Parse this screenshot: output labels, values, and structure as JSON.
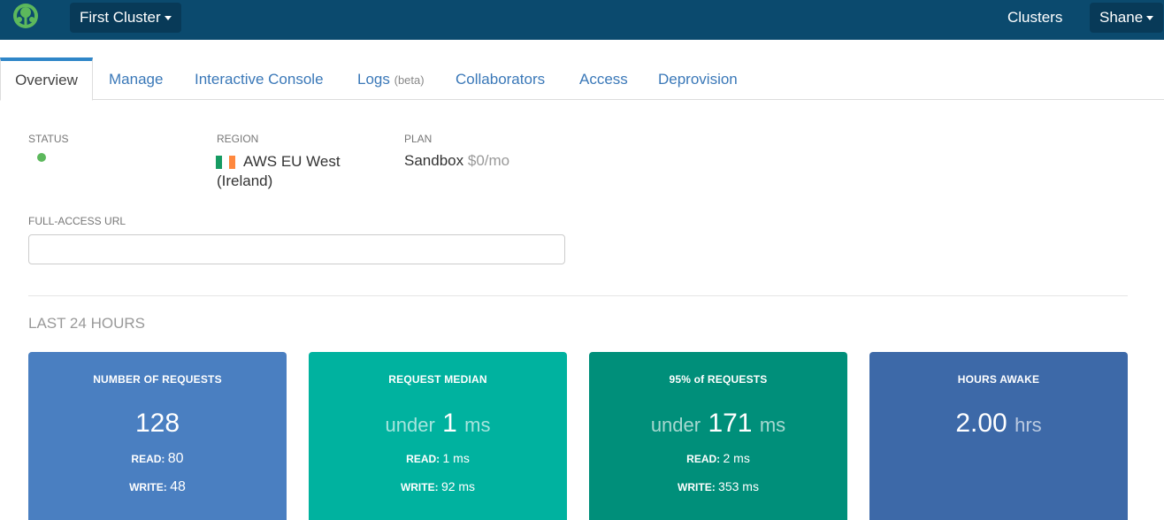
{
  "header": {
    "cluster_name": "First Cluster",
    "clusters_link": "Clusters",
    "user_name": "Shane"
  },
  "tabs": [
    {
      "label": "Overview"
    },
    {
      "label": "Manage"
    },
    {
      "label": "Interactive Console"
    },
    {
      "label": "Logs",
      "suffix": "(beta)"
    },
    {
      "label": "Collaborators"
    },
    {
      "label": "Access"
    },
    {
      "label": "Deprovision"
    }
  ],
  "overview": {
    "status_label": "STATUS",
    "region_label": "REGION",
    "region_value": "AWS EU West (Ireland)",
    "plan_label": "PLAN",
    "plan_name": "Sandbox",
    "plan_price": "$0/mo",
    "url_label": "FULL-ACCESS URL",
    "url_value": ""
  },
  "stats": {
    "section_title": "LAST 24 HOURS",
    "cards": [
      {
        "title": "NUMBER OF REQUESTS",
        "prefix": "",
        "value": "128",
        "unit": "",
        "read_label": "READ:",
        "read_value": "80",
        "write_label": "WRITE:",
        "write_value": "48",
        "color": "#4a7fc1"
      },
      {
        "title": "REQUEST MEDIAN",
        "prefix": "under",
        "value": "1",
        "unit": "ms",
        "read_label": "READ:",
        "read_value": "1 ms",
        "write_label": "WRITE:",
        "write_value": "92 ms",
        "color": "#00b29f"
      },
      {
        "title": "95% of REQUESTS",
        "prefix": "under",
        "value": "171",
        "unit": "ms",
        "read_label": "READ:",
        "read_value": "2 ms",
        "write_label": "WRITE:",
        "write_value": "353 ms",
        "color": "#008f7a"
      },
      {
        "title": "HOURS AWAKE",
        "prefix": "",
        "value": "2.00",
        "unit": "hrs",
        "color": "#3d69a8"
      }
    ]
  },
  "colors": {
    "topbar": "#0b4a6e",
    "status_ok": "#5cb85c",
    "link": "#3a78b8"
  },
  "icons": {
    "logo": "tree-logo-icon",
    "flag": "ireland-flag-icon"
  }
}
